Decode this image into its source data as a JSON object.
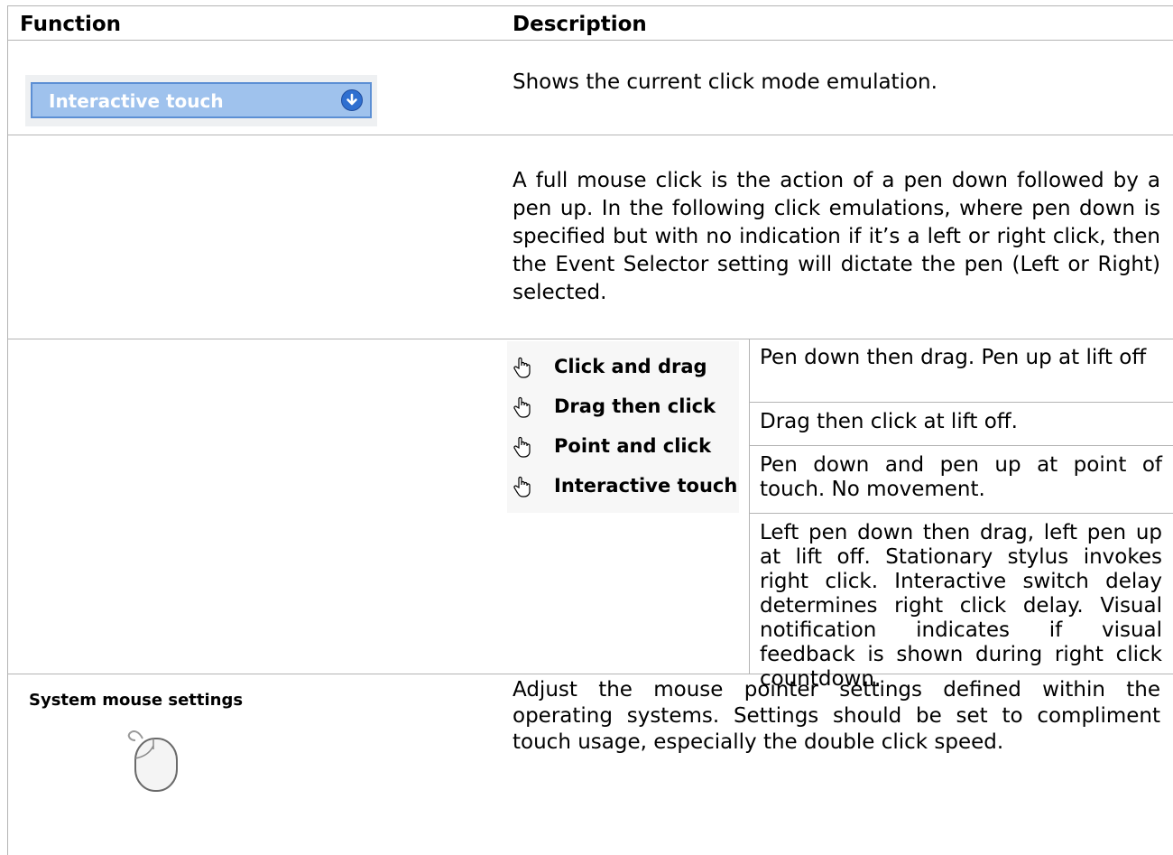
{
  "table": {
    "headers": {
      "function": "Function",
      "description": "Description"
    },
    "rows": {
      "dropdown": {
        "widget_value": "Interactive touch",
        "description": "Shows the current click mode emulation."
      },
      "full_click": {
        "description": "A full mouse click is the action of a pen down followed by a pen up. In the following click emulations, where pen down is specified but with no indication if it’s a left or right click, then the Event Selector setting will dictate the pen (Left or Right) selected."
      },
      "modes": {
        "menu_items": [
          {
            "label": "Click and drag",
            "icon": "hand-pointer-icon"
          },
          {
            "label": "Drag then click",
            "icon": "hand-pointer-icon"
          },
          {
            "label": "Point and click",
            "icon": "hand-pointer-icon"
          },
          {
            "label": "Interactive touch",
            "icon": "hand-pointer-icon"
          }
        ],
        "descriptions": [
          "Pen down then drag. Pen up at lift off",
          "Drag then click at lift off.",
          "Pen down and pen up at point of touch. No movement.",
          "Left pen down then drag, left pen up at lift off. Stationary stylus invokes right click. Interactive switch delay determines right click delay. Visual notification indicates if visual feedback is shown during right click countdown."
        ]
      },
      "system_mouse": {
        "title": "System mouse settings",
        "icon": "mouse-icon",
        "description": "Adjust the mouse pointer settings defined within the operating systems. Settings should be set to compliment touch usage, especially the double click speed."
      }
    }
  },
  "colors": {
    "grid": "#b4b4b4",
    "dropdown_fill": "#9fc2ed",
    "dropdown_border": "#5c8fd4",
    "dropdown_button": "#2f6fd0"
  }
}
